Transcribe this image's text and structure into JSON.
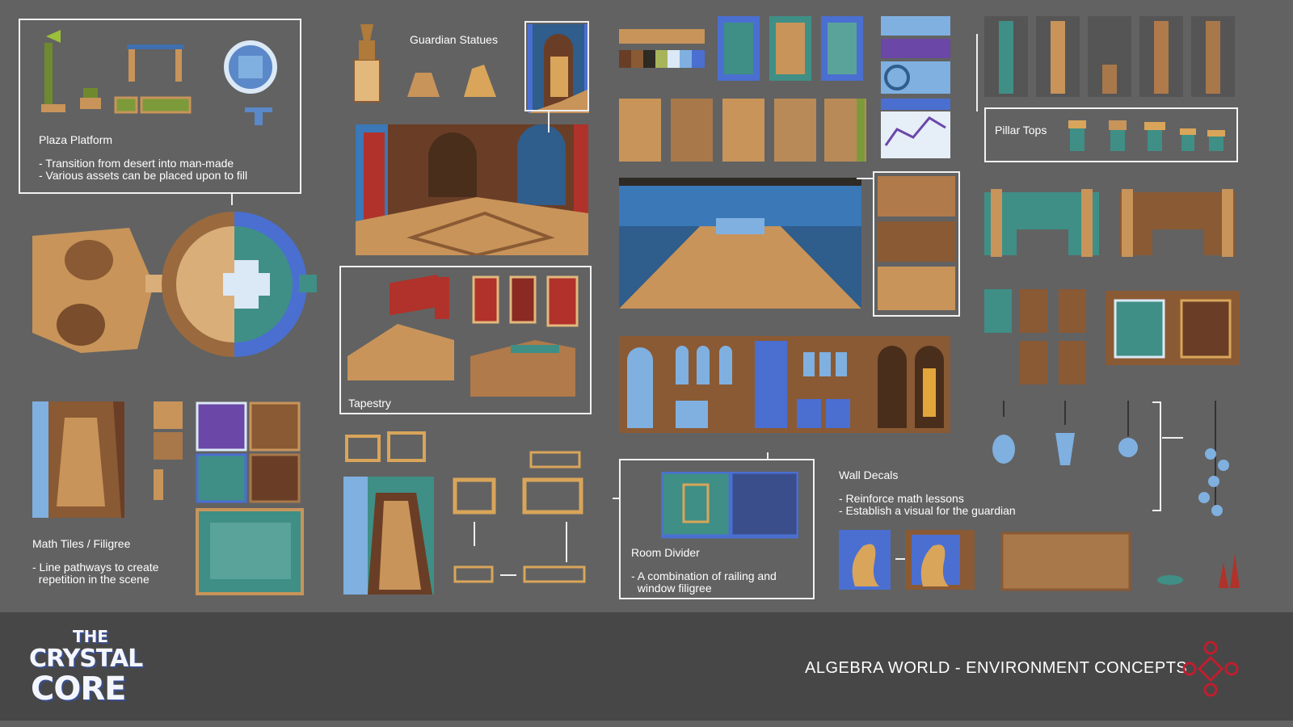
{
  "sections": {
    "plaza": {
      "title": "Plaza Platform",
      "notes": "- Transition from desert into man-made\n- Various assets can be placed upon to fill"
    },
    "guardian": {
      "title": "Guardian Statues"
    },
    "tapestry": {
      "title": "Tapestry"
    },
    "pillars": {
      "title": "Pillar Tops"
    },
    "math_tiles": {
      "title": "Math Tiles / Filigree",
      "notes": "- Line pathways to create\n  repetition in the scene"
    },
    "room_divider": {
      "title": "Room Divider",
      "notes": "- A combination of railing and\n  window filigree"
    },
    "wall_decals": {
      "title": "Wall Decals",
      "notes": "- Reinforce math lessons\n- Establish a visual for the guardian"
    }
  },
  "footer": {
    "title": "ALGEBRA WORLD - ENVIRONMENT CONCEPTS",
    "logo_line1": "THE",
    "logo_line2": "CRYSTAL",
    "logo_line3": "CORE"
  },
  "colors": {
    "background": "#626262",
    "footer": "#474747",
    "sand": "#c8945a",
    "brown": "#8a5a34",
    "teal": "#3f8f86",
    "blue": "#4a6fd1",
    "red": "#c23a2e",
    "olive": "#7d9a3a"
  }
}
